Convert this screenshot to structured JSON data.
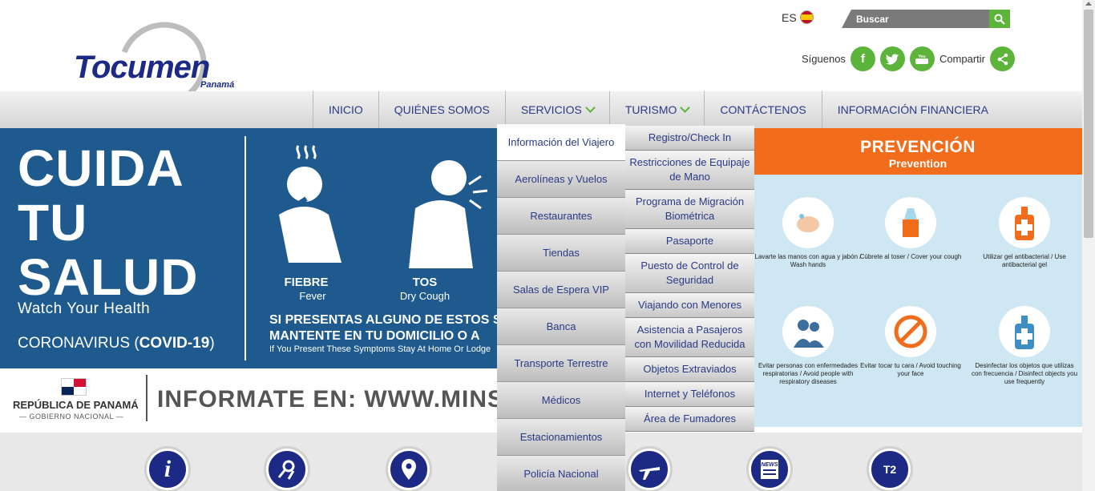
{
  "header": {
    "logo_text": "Tocumen",
    "logo_sub": "Panamá",
    "lang_label": "ES",
    "search_placeholder": "Buscar",
    "follow_label": "Síguenos",
    "share_label": "Compartir",
    "social_icons": [
      "facebook-icon",
      "twitter-icon",
      "youtube-icon",
      "share-icon"
    ]
  },
  "nav": {
    "items": [
      {
        "label": "INICIO"
      },
      {
        "label": "QUIÉNES SOMOS"
      },
      {
        "label": "SERVICIOS"
      },
      {
        "label": "TURISMO"
      },
      {
        "label": "CONTÁCTENOS"
      },
      {
        "label": "INFORMACIÓN FINANCIERA"
      }
    ]
  },
  "dropdown": {
    "col1": [
      "Información del Viajero",
      "Aerolíneas y Vuelos",
      "Restaurantes",
      "Tiendas",
      "Salas de Espera VIP",
      "Banca",
      "Transporte Terrestre",
      "Médicos",
      "Estacionamientos",
      "Policía Nacional"
    ],
    "col2": [
      "Registro/Check In",
      "Restricciones de Equipaje de Mano",
      "Programa de Migración Biométrica",
      "Pasaporte",
      "Puesto de Control de Seguridad",
      "Viajando con Menores",
      "Asistencia a Pasajeros con Movilidad Reducida",
      "Objetos Extraviados",
      "Internet y Teléfonos",
      "Área de Fumadores"
    ]
  },
  "banner": {
    "title_lines": [
      "CUIDA",
      "TU",
      "SALUD"
    ],
    "subtitle": "Watch Your Health",
    "corona_prefix": "CORONAVIRUS (",
    "corona_bold": "COVID-19",
    "corona_suffix": ")",
    "fiebre": "FIEBRE",
    "fever": "Fever",
    "tos": "TOS",
    "dry_cough": "Dry Cough",
    "notice_line1": "SI PRESENTAS ALGUNO DE ESTOS S",
    "notice_line2": "MANTENTE EN TU DOMICILIO O A",
    "notice_en": "If You Present These Symptoms Stay At Home Or Lodge"
  },
  "prevention": {
    "title": "PREVENCIÓN",
    "subtitle": "Prevention",
    "items": [
      "Lavarte las manos con agua y jabón / Wash hands",
      "Cúbrete al toser / Cover your cough",
      "Utilizar gel antibacterial / Use antibacterial gel",
      "Evitar personas con enfermedades respiratorias / Avoid people with respiratory diseases",
      "Evitar tocar tu cara / Avoid touching your face",
      "Desinfectar los objetos que utilizas con frecuencia / Disinfect objects you use frequently"
    ]
  },
  "infostrip": {
    "republica": "REPÚBLICA DE PANAMÁ",
    "gobierno": "— GOBIERNO NACIONAL —",
    "informate": "INFORMATE EN: WWW.MINSA"
  },
  "bottom_icons": [
    "info-icon",
    "food-icon",
    "location-icon",
    "plane-icon",
    "news-icon",
    "t2-icon"
  ],
  "bottom_labels": {
    "news": "NEWS",
    "t2": "T2"
  },
  "colors": {
    "brand_blue": "#1c2a85",
    "green": "#5cb53a",
    "orange": "#f26d1b",
    "banner_blue": "#1e5a8e"
  }
}
